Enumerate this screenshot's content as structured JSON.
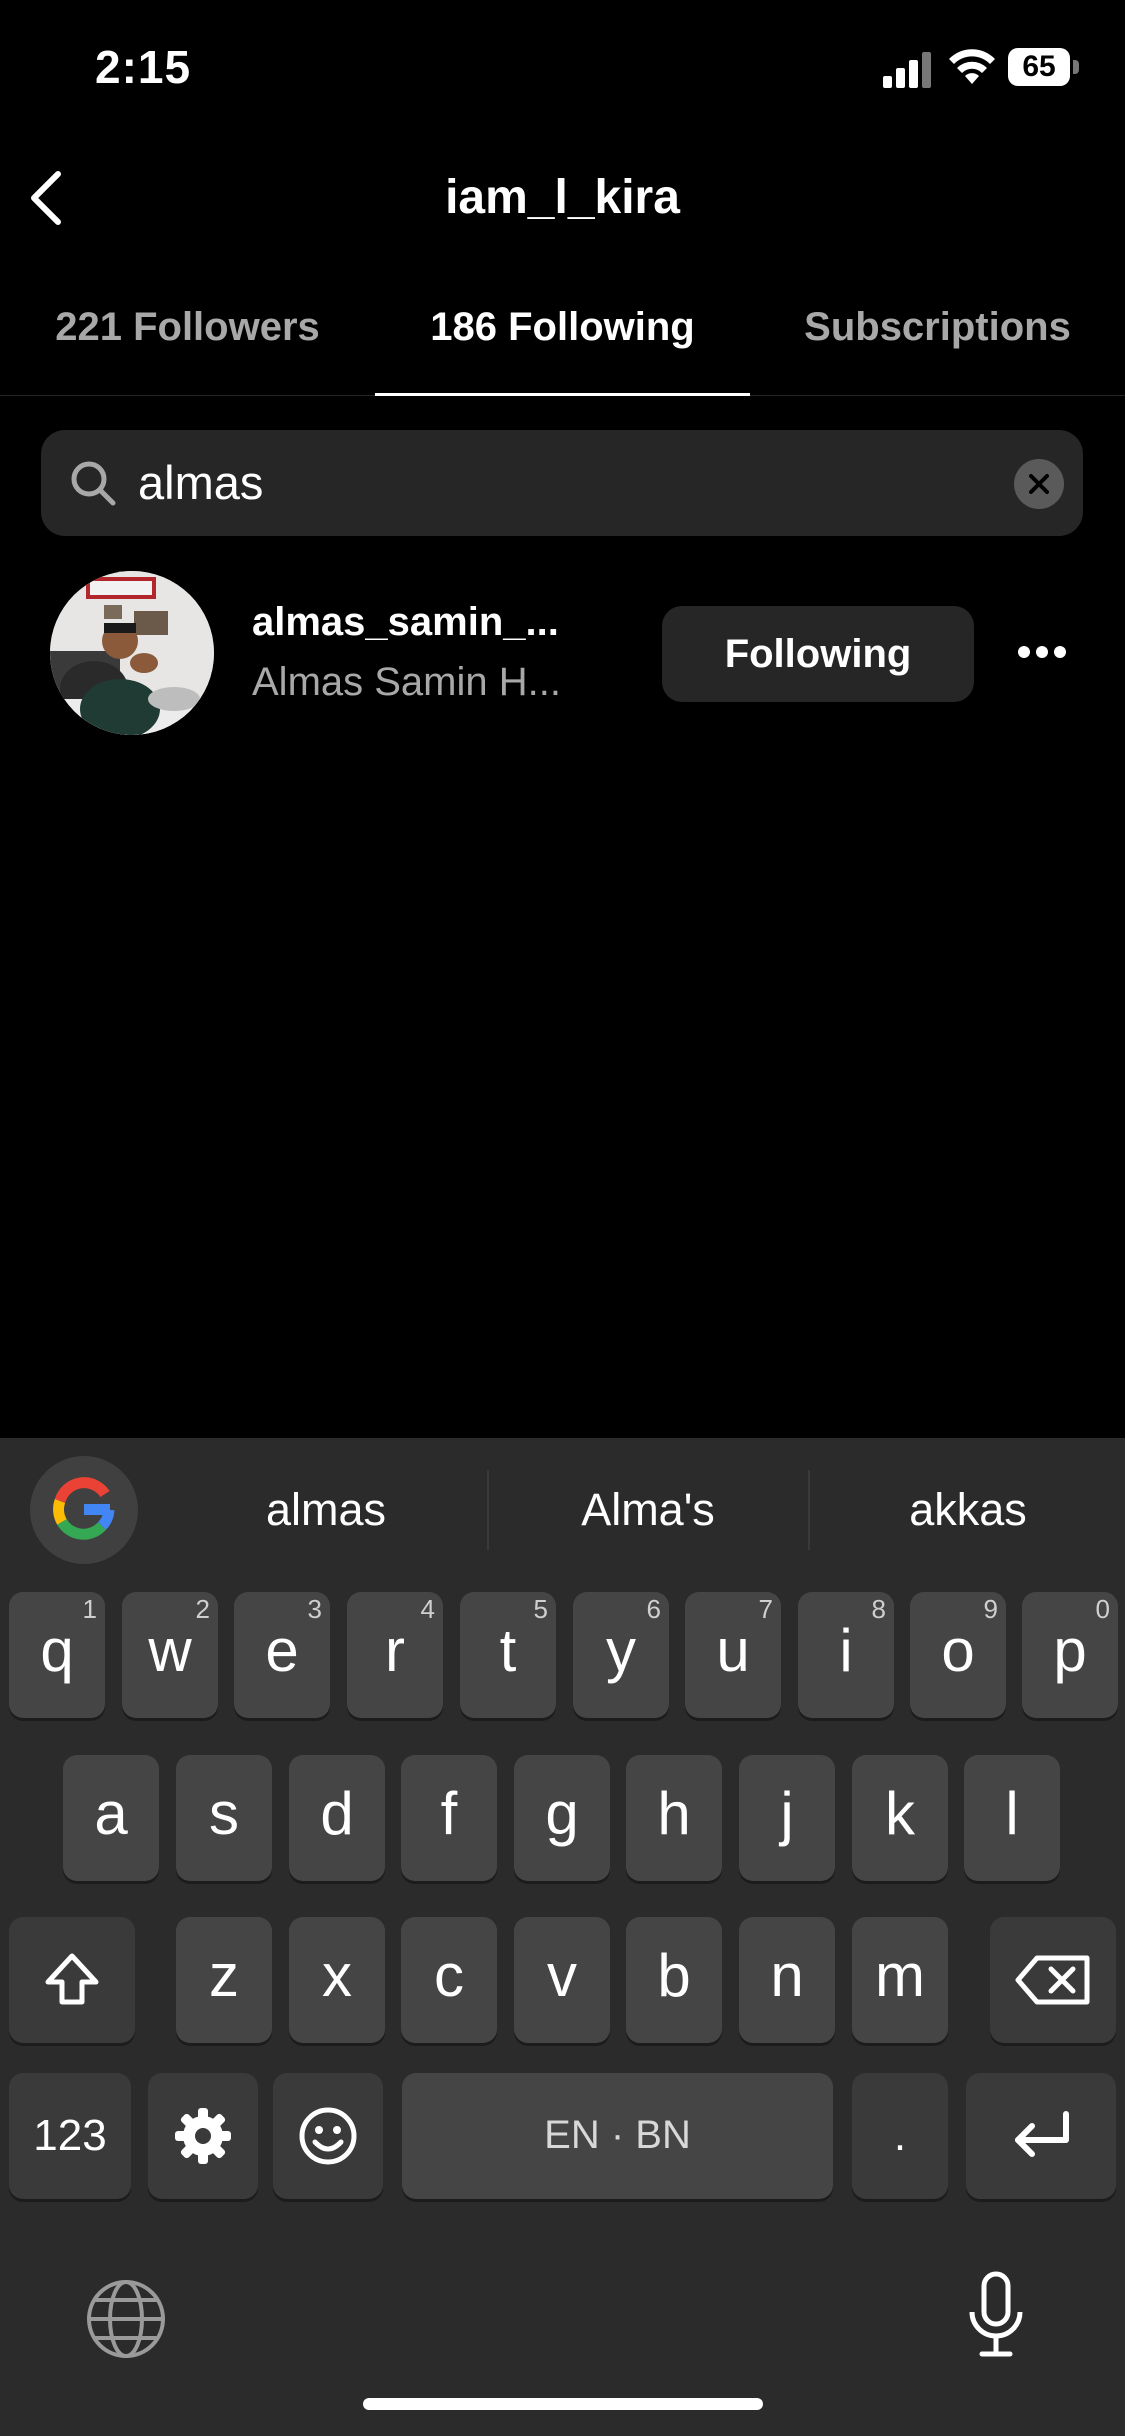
{
  "status_bar": {
    "time": "2:15",
    "battery": "65"
  },
  "nav": {
    "title": "iam_l_kira"
  },
  "tabs": [
    {
      "label": "221 Followers"
    },
    {
      "label": "186 Following"
    },
    {
      "label": "Subscriptions"
    }
  ],
  "search": {
    "value": "almas"
  },
  "results": [
    {
      "username": "almas_samin_...",
      "full_name": "Almas Samin H...",
      "button": "Following"
    }
  ],
  "keyboard": {
    "suggestions": [
      "almas",
      "Alma's",
      "akkas"
    ],
    "row1": [
      {
        "key": "q",
        "hint": "1"
      },
      {
        "key": "w",
        "hint": "2"
      },
      {
        "key": "e",
        "hint": "3"
      },
      {
        "key": "r",
        "hint": "4"
      },
      {
        "key": "t",
        "hint": "5"
      },
      {
        "key": "y",
        "hint": "6"
      },
      {
        "key": "u",
        "hint": "7"
      },
      {
        "key": "i",
        "hint": "8"
      },
      {
        "key": "o",
        "hint": "9"
      },
      {
        "key": "p",
        "hint": "0"
      }
    ],
    "row2": [
      "a",
      "s",
      "d",
      "f",
      "g",
      "h",
      "j",
      "k",
      "l"
    ],
    "row3": [
      "z",
      "x",
      "c",
      "v",
      "b",
      "n",
      "m"
    ],
    "numbers_key": "123",
    "space_label": "EN · BN",
    "period_key": "."
  }
}
